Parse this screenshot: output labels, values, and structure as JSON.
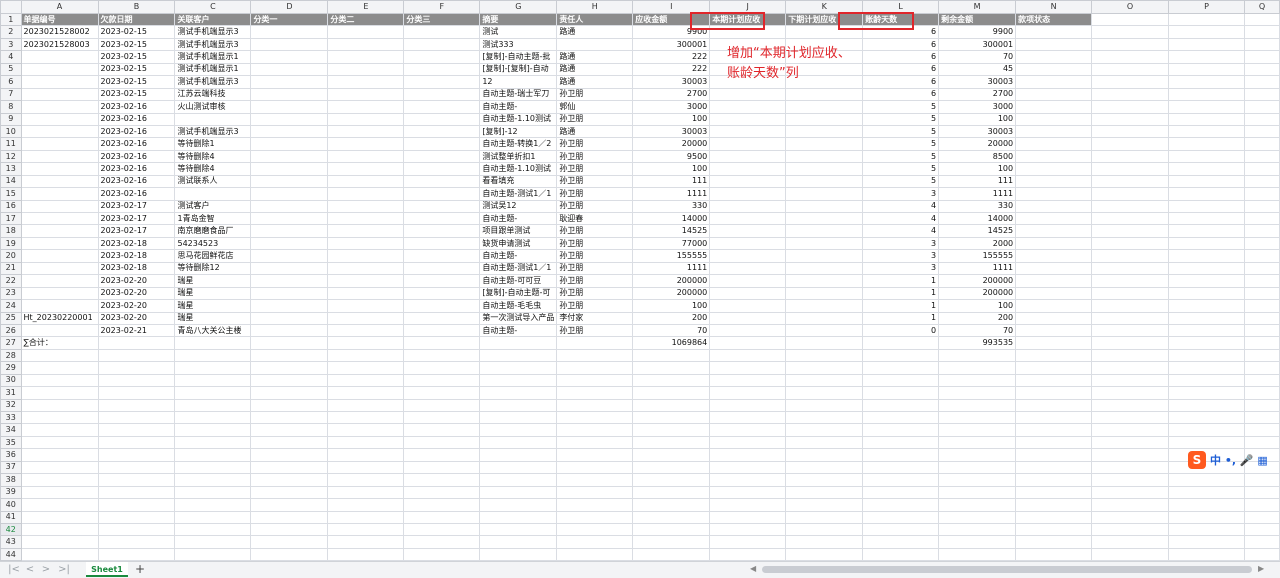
{
  "columns": [
    "A",
    "B",
    "C",
    "D",
    "E",
    "F",
    "G",
    "H",
    "I",
    "J",
    "K",
    "L",
    "M",
    "N",
    "O",
    "P",
    "Q"
  ],
  "header": [
    "单据编号",
    "欠款日期",
    "关联客户",
    "分类一",
    "分类二",
    "分类三",
    "摘要",
    "责任人",
    "应收金额",
    "本期计划应收",
    "下期计划应收",
    "账龄天数",
    "剩余金额",
    "款项状态",
    "",
    "",
    ""
  ],
  "rows": [
    [
      "2023021528002",
      "2023-02-15",
      "测试手机端显示3",
      "",
      "",
      "",
      "测试",
      "路通",
      "9900",
      "",
      "",
      "6",
      "9900",
      "",
      "",
      "",
      ""
    ],
    [
      "2023021528003",
      "2023-02-15",
      "测试手机端显示3",
      "",
      "",
      "",
      "测试333",
      "",
      "300001",
      "",
      "",
      "6",
      "300001",
      "",
      "",
      "",
      ""
    ],
    [
      "",
      "2023-02-15",
      "测试手机端显示1",
      "",
      "",
      "",
      "[复制]-自动主题-批",
      "路通",
      "222",
      "",
      "",
      "6",
      "70",
      "",
      "",
      "",
      ""
    ],
    [
      "",
      "2023-02-15",
      "测试手机端显示1",
      "",
      "",
      "",
      "[复制]-[复制]-自动",
      "路通",
      "222",
      "",
      "",
      "6",
      "45",
      "",
      "",
      "",
      ""
    ],
    [
      "",
      "2023-02-15",
      "测试手机端显示3",
      "",
      "",
      "",
      "12",
      "路通",
      "30003",
      "",
      "",
      "6",
      "30003",
      "",
      "",
      "",
      ""
    ],
    [
      "",
      "2023-02-15",
      "江苏云端科技",
      "",
      "",
      "",
      "自动主题-瑞士军刀",
      "孙卫朋",
      "2700",
      "",
      "",
      "6",
      "2700",
      "",
      "",
      "",
      ""
    ],
    [
      "",
      "2023-02-16",
      "火山测试审核",
      "",
      "",
      "",
      "自动主题-",
      "郭仙",
      "3000",
      "",
      "",
      "5",
      "3000",
      "",
      "",
      "",
      ""
    ],
    [
      "",
      "2023-02-16",
      "",
      "",
      "",
      "",
      "自动主题-1.10测试",
      "孙卫朋",
      "100",
      "",
      "",
      "5",
      "100",
      "",
      "",
      "",
      ""
    ],
    [
      "",
      "2023-02-16",
      "测试手机端显示3",
      "",
      "",
      "",
      "[复制]-12",
      "路通",
      "30003",
      "",
      "",
      "5",
      "30003",
      "",
      "",
      "",
      ""
    ],
    [
      "",
      "2023-02-16",
      "等待删除1",
      "",
      "",
      "",
      "自动主题-转换1／2",
      "孙卫朋",
      "20000",
      "",
      "",
      "5",
      "20000",
      "",
      "",
      "",
      ""
    ],
    [
      "",
      "2023-02-16",
      "等待删除4",
      "",
      "",
      "",
      "测试整单折扣1",
      "孙卫朋",
      "9500",
      "",
      "",
      "5",
      "8500",
      "",
      "",
      "",
      ""
    ],
    [
      "",
      "2023-02-16",
      "等待删除4",
      "",
      "",
      "",
      "自动主题-1.10测试",
      "孙卫朋",
      "100",
      "",
      "",
      "5",
      "100",
      "",
      "",
      "",
      ""
    ],
    [
      "",
      "2023-02-16",
      "测试联系人",
      "",
      "",
      "",
      "看看填充",
      "孙卫朋",
      "111",
      "",
      "",
      "5",
      "111",
      "",
      "",
      "",
      ""
    ],
    [
      "",
      "2023-02-16",
      "",
      "",
      "",
      "",
      "自动主题-测试1／1",
      "孙卫朋",
      "1111",
      "",
      "",
      "3",
      "1111",
      "",
      "",
      "",
      ""
    ],
    [
      "",
      "2023-02-17",
      "测试客户",
      "",
      "",
      "",
      "测试吴12",
      "孙卫朋",
      "330",
      "",
      "",
      "4",
      "330",
      "",
      "",
      "",
      ""
    ],
    [
      "",
      "2023-02-17",
      "1青岛金智",
      "",
      "",
      "",
      "自动主题-",
      "耿迎春",
      "14000",
      "",
      "",
      "4",
      "14000",
      "",
      "",
      "",
      ""
    ],
    [
      "",
      "2023-02-17",
      "南京磨磨食品厂",
      "",
      "",
      "",
      "项目跟单测试",
      "孙卫朋",
      "14525",
      "",
      "",
      "4",
      "14525",
      "",
      "",
      "",
      ""
    ],
    [
      "",
      "2023-02-18",
      "54234523",
      "",
      "",
      "",
      "缺货申请测试",
      "孙卫朋",
      "77000",
      "",
      "",
      "3",
      "2000",
      "",
      "",
      "",
      ""
    ],
    [
      "",
      "2023-02-18",
      "思马花园鲜花店",
      "",
      "",
      "",
      "自动主题-",
      "孙卫朋",
      "155555",
      "",
      "",
      "3",
      "155555",
      "",
      "",
      "",
      ""
    ],
    [
      "",
      "2023-02-18",
      "等待删除12",
      "",
      "",
      "",
      "自动主题-测试1／1",
      "孙卫朋",
      "1111",
      "",
      "",
      "3",
      "1111",
      "",
      "",
      "",
      ""
    ],
    [
      "",
      "2023-02-20",
      "瑞星",
      "",
      "",
      "",
      "自动主题-可可豆",
      "孙卫朋",
      "200000",
      "",
      "",
      "1",
      "200000",
      "",
      "",
      "",
      ""
    ],
    [
      "",
      "2023-02-20",
      "瑞星",
      "",
      "",
      "",
      "[复制]-自动主题-可",
      "孙卫朋",
      "200000",
      "",
      "",
      "1",
      "200000",
      "",
      "",
      "",
      ""
    ],
    [
      "",
      "2023-02-20",
      "瑞星",
      "",
      "",
      "",
      "自动主题-毛毛虫",
      "孙卫朋",
      "100",
      "",
      "",
      "1",
      "100",
      "",
      "",
      "",
      ""
    ],
    [
      "Ht_20230220001",
      "2023-02-20",
      "瑞星",
      "",
      "",
      "",
      "第一次测试导入产品",
      "李付家",
      "200",
      "",
      "",
      "1",
      "200",
      "",
      "",
      "",
      ""
    ],
    [
      "",
      "2023-02-21",
      "青岛八大关公主楼",
      "",
      "",
      "",
      "自动主题-",
      "孙卫朋",
      "70",
      "",
      "",
      "0",
      "70",
      "",
      "",
      "",
      ""
    ],
    [
      "∑合计：",
      "",
      "",
      "",
      "",
      "",
      "",
      "",
      "1069864",
      "",
      "",
      "",
      "993535",
      "",
      "",
      "",
      ""
    ]
  ],
  "empty_row_start": 28,
  "empty_row_end": 47,
  "selected_row": 42,
  "annotation": {
    "line1": "增加“本期计划应收、",
    "line2": "账龄天数”列"
  },
  "sheet_tab": "Sheet1",
  "nav": {
    "first": "|<",
    "prev": "<",
    "next": ">",
    "last": ">|"
  },
  "add_tab": "+",
  "ime": {
    "logo": "S",
    "text": "中 •, 🎤 ▦"
  },
  "colors": {
    "header_bg": "#8c8c8c",
    "highlight": "#e0262b",
    "tab_green": "#1a8a3e"
  }
}
